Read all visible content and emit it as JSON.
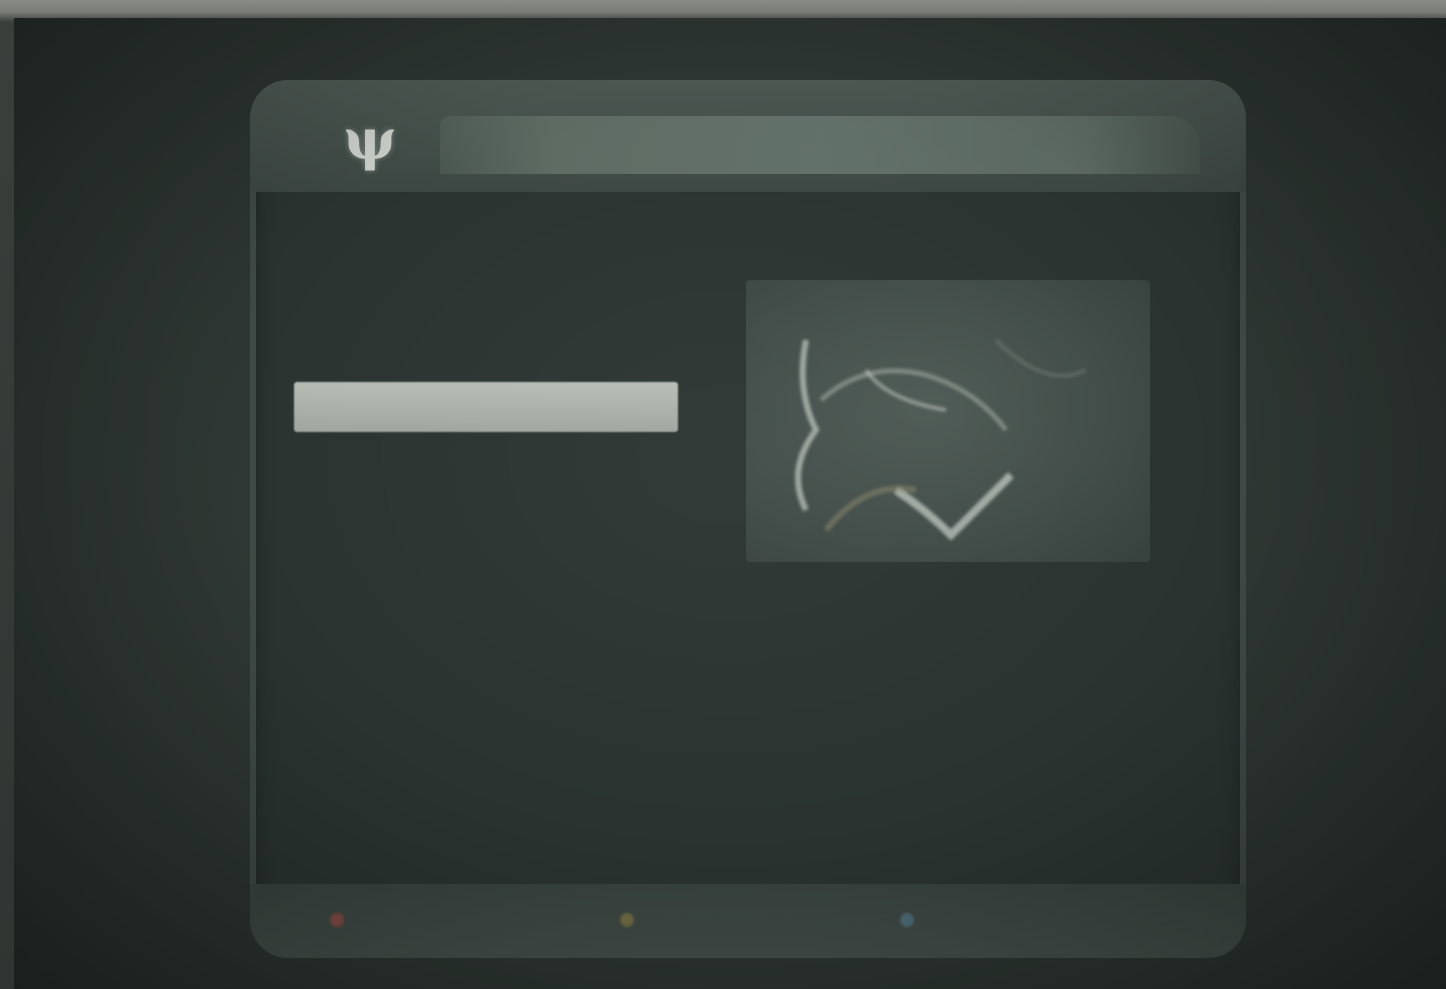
{
  "header": {
    "logo_glyph": "ψ",
    "title": ""
  },
  "menu": {
    "items": [
      {
        "label": "",
        "selected": false
      },
      {
        "label": "",
        "selected": false
      },
      {
        "label": "",
        "selected": true
      },
      {
        "label": "",
        "selected": false
      },
      {
        "label": "",
        "selected": false
      },
      {
        "label": "",
        "selected": false
      },
      {
        "label": "",
        "selected": false
      },
      {
        "label": "",
        "selected": false
      },
      {
        "label": "",
        "selected": false
      }
    ]
  },
  "preview": {
    "text": ""
  },
  "footer": {
    "items": [
      {
        "label": "",
        "key_color": "#7f4a44"
      },
      {
        "label": "",
        "key_color": "#6f6a44"
      },
      {
        "label": "",
        "key_color": "#4c6a74"
      }
    ]
  },
  "colors": {
    "screen_bg": "#2e3633",
    "panel_bg": "#2a3330",
    "highlight": "#b7bcb5",
    "text_dim": "#6f7a74"
  }
}
